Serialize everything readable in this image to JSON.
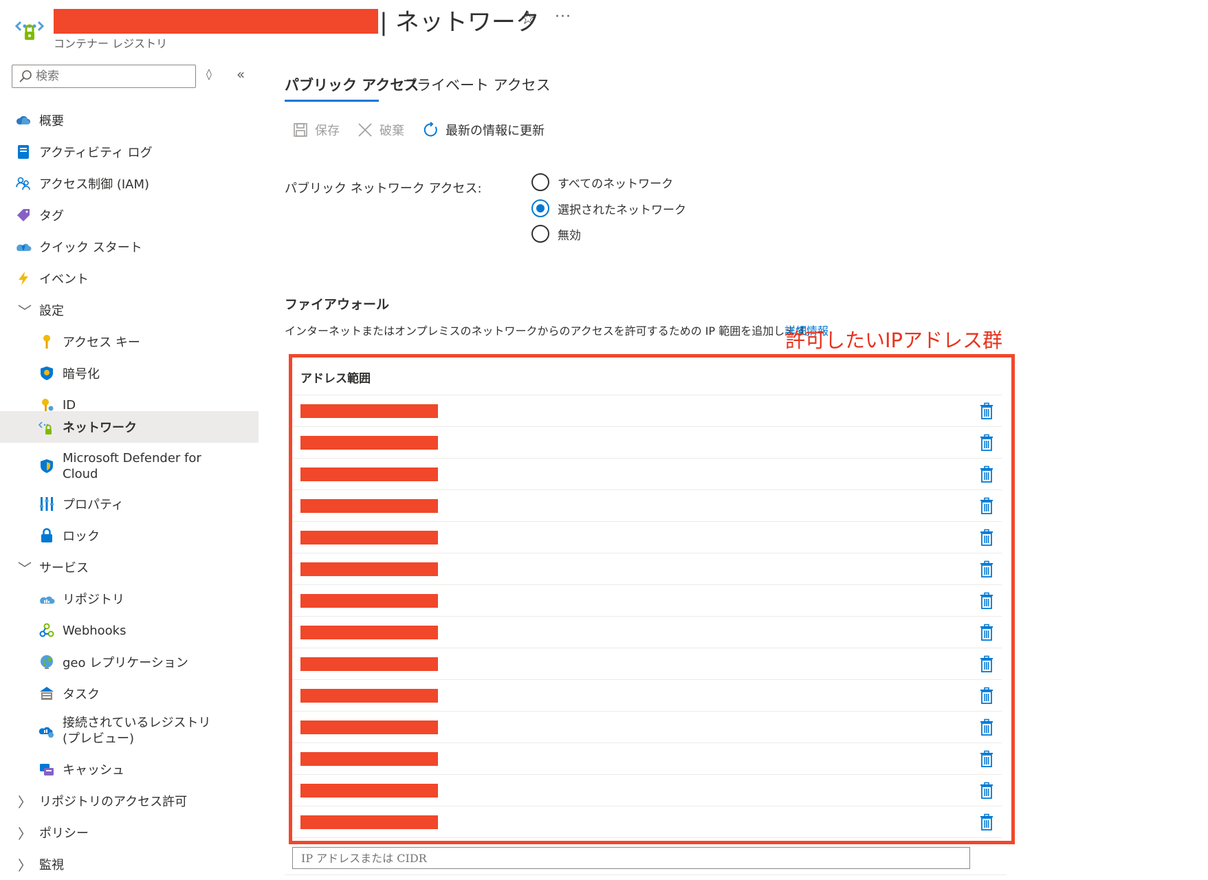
{
  "header": {
    "title": "| ネットワーク",
    "subtitle": "コンテナー レジストリ",
    "star_glyph": "☆",
    "more_glyph": "···"
  },
  "sidebar": {
    "search_placeholder": "検索",
    "sort_glyph": "◊",
    "collapse_glyph": "«",
    "items": [
      {
        "label": "概要",
        "icon": "cloud-overview-icon",
        "level": 0
      },
      {
        "label": "アクティビティ ログ",
        "icon": "activity-log-icon",
        "level": 0
      },
      {
        "label": "アクセス制御 (IAM)",
        "icon": "people-iam-icon",
        "level": 0
      },
      {
        "label": "タグ",
        "icon": "tag-icon",
        "level": 0
      },
      {
        "label": "クイック スタート",
        "icon": "quickstart-cloud-icon",
        "level": 0
      },
      {
        "label": "イベント",
        "icon": "lightning-icon",
        "level": 0
      },
      {
        "label": "設定",
        "icon": "chevron-down-icon",
        "level": 0,
        "section": true,
        "chevron": "﹀"
      },
      {
        "label": "アクセス キー",
        "icon": "key-icon",
        "level": 1
      },
      {
        "label": "暗号化",
        "icon": "shield-icon",
        "level": 1
      },
      {
        "label": "ID",
        "icon": "identity-key-icon",
        "level": 1
      },
      {
        "label": "ネットワーク",
        "icon": "network-icon",
        "level": 1,
        "active": true
      },
      {
        "label": "Microsoft Defender for Cloud",
        "icon": "defender-shield-icon",
        "level": 1
      },
      {
        "label": "プロパティ",
        "icon": "properties-icon",
        "level": 1
      },
      {
        "label": "ロック",
        "icon": "lock-icon",
        "level": 1
      },
      {
        "label": "サービス",
        "icon": "chevron-down-icon",
        "level": 0,
        "section": true,
        "chevron": "﹀"
      },
      {
        "label": "リポジトリ",
        "icon": "repository-cloud-icon",
        "level": 1
      },
      {
        "label": "Webhooks",
        "icon": "webhooks-icon",
        "level": 1
      },
      {
        "label": "geo レプリケーション",
        "icon": "globe-icon",
        "level": 1
      },
      {
        "label": "タスク",
        "icon": "tasks-icon",
        "level": 1
      },
      {
        "label": "接続されているレジストリ (プレビュー)",
        "icon": "connected-registry-icon",
        "level": 1
      },
      {
        "label": "キャッシュ",
        "icon": "cache-icon",
        "level": 1
      },
      {
        "label": "リポジトリのアクセス許可",
        "icon": "chevron-right-icon",
        "level": 0,
        "section": true,
        "chevron": "〉"
      },
      {
        "label": "ポリシー",
        "icon": "chevron-right-icon",
        "level": 0,
        "section": true,
        "chevron": "〉"
      },
      {
        "label": "監視",
        "icon": "chevron-right-icon",
        "level": 0,
        "section": true,
        "chevron": "〉"
      }
    ]
  },
  "tabs": [
    {
      "label": "パブリック アクセス",
      "active": true
    },
    {
      "label": "プライベート アクセス",
      "active": false
    }
  ],
  "toolbar": {
    "save_label": "保存",
    "discard_label": "破棄",
    "refresh_label": "最新の情報に更新"
  },
  "public_network_access": {
    "label": "パブリック ネットワーク アクセス:",
    "options": [
      {
        "label": "すべてのネットワーク",
        "selected": false
      },
      {
        "label": "選択されたネットワーク",
        "selected": true
      },
      {
        "label": "無効",
        "selected": false
      }
    ]
  },
  "firewall": {
    "title": "ファイアウォール",
    "description": "インターネットまたはオンプレミスのネットワークからのアクセスを許可するための IP 範囲を追加します。",
    "link_label": "詳細情報",
    "column_header": "アドレス範囲",
    "row_count": 14,
    "new_ip_placeholder": "IP アドレスまたは CIDR"
  },
  "annotation": {
    "label": "許可したいIPアドレス群",
    "color": "#e8331e"
  },
  "colors": {
    "accent": "#0078d4",
    "redaction": "#f1472a",
    "active_nav_bg": "#edebe9"
  }
}
